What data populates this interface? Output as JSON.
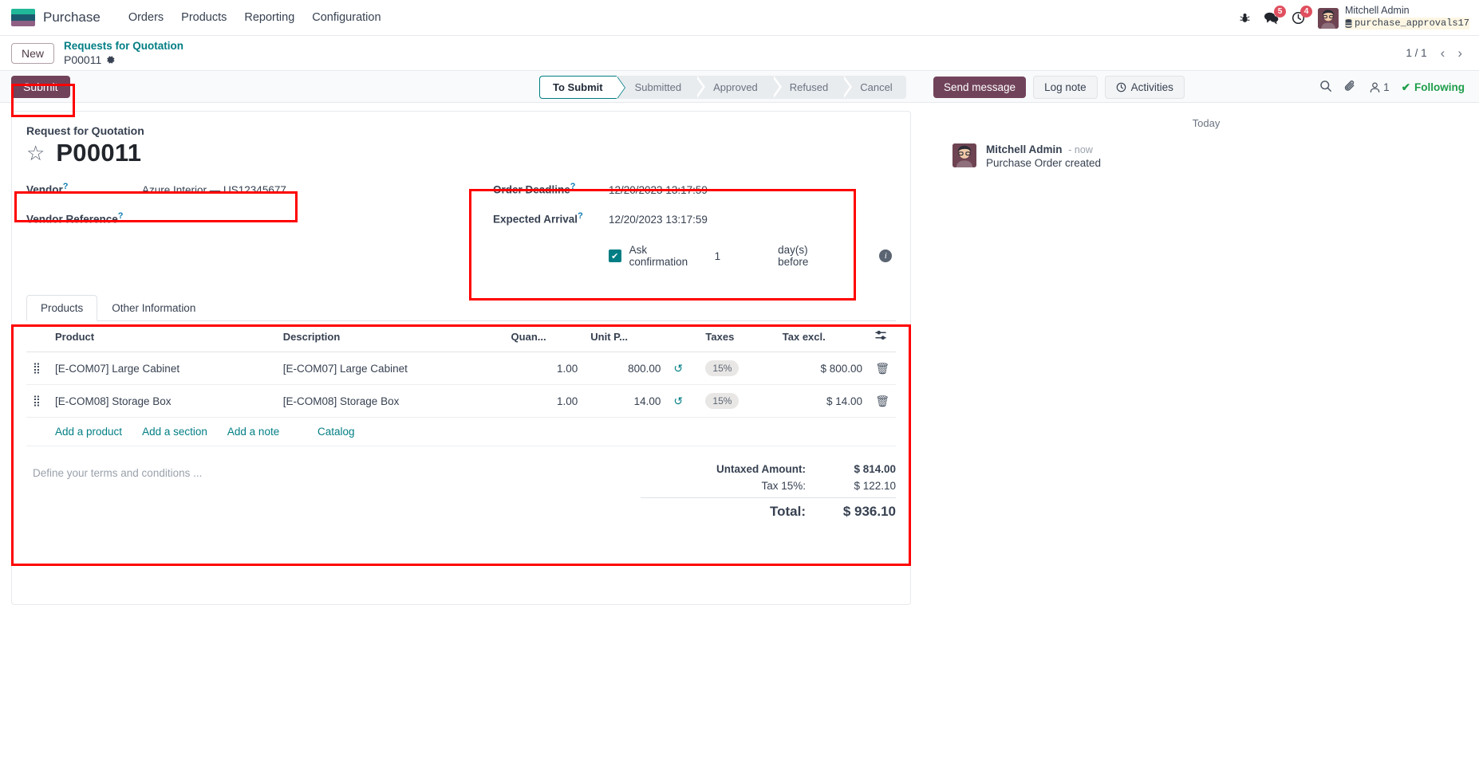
{
  "navbar": {
    "app_name": "Purchase",
    "menus": [
      "Orders",
      "Products",
      "Reporting",
      "Configuration"
    ],
    "bug_icon": "bug-icon",
    "messages_badge": "5",
    "activities_badge": "4",
    "user_name": "Mitchell Admin",
    "db_name": "purchase_approvals17"
  },
  "breadcrumb": {
    "new_label": "New",
    "parent": "Requests for Quotation",
    "current": "P00011",
    "pager": "1 / 1"
  },
  "controlpanel": {
    "submit_label": "Submit",
    "statuses": [
      "To Submit",
      "Submitted",
      "Approved",
      "Refused",
      "Cancel"
    ],
    "send_message": "Send message",
    "log_note": "Log note",
    "activities": "Activities",
    "follower_count": "1",
    "following_label": "Following"
  },
  "form": {
    "subtitle": "Request for Quotation",
    "record_name": "P00011",
    "vendor_label": "Vendor",
    "vendor_value": "Azure Interior — US12345677",
    "vendor_ref_label": "Vendor Reference",
    "vendor_ref_value": "",
    "order_deadline_label": "Order Deadline",
    "order_deadline_value": "12/20/2023 13:17:59",
    "expected_arrival_label": "Expected Arrival",
    "expected_arrival_value": "12/20/2023 13:17:59",
    "ask_confirmation_label": "Ask confirmation",
    "ask_confirmation_days": "1",
    "days_before_label": "day(s) before",
    "ask_confirmation_checked": true
  },
  "notebook": {
    "tabs": [
      {
        "label": "Products",
        "active": true
      },
      {
        "label": "Other Information",
        "active": false
      }
    ]
  },
  "lines_table": {
    "columns": [
      "Product",
      "Description",
      "Quan...",
      "Unit P...",
      "",
      "Taxes",
      "Tax excl.",
      ""
    ],
    "rows": [
      {
        "product": "[E-COM07] Large Cabinet",
        "description": "[E-COM07] Large Cabinet",
        "quantity": "1.00",
        "unit_price": "800.00",
        "taxes": "15%",
        "tax_excl": "$ 800.00"
      },
      {
        "product": "[E-COM08] Storage Box",
        "description": "[E-COM08] Storage Box",
        "quantity": "1.00",
        "unit_price": "14.00",
        "taxes": "15%",
        "tax_excl": "$ 14.00"
      }
    ],
    "add_product": "Add a product",
    "add_section": "Add a section",
    "add_note": "Add a note",
    "catalog": "Catalog"
  },
  "footer": {
    "terms_placeholder": "Define your terms and conditions ...",
    "untaxed_label": "Untaxed Amount:",
    "untaxed_value": "$ 814.00",
    "tax_label": "Tax 15%:",
    "tax_value": "$ 122.10",
    "total_label": "Total:",
    "total_value": "$ 936.10"
  },
  "chatter": {
    "day_separator": "Today",
    "message_author": "Mitchell Admin",
    "message_time": "- now",
    "message_body": "Purchase Order created"
  }
}
